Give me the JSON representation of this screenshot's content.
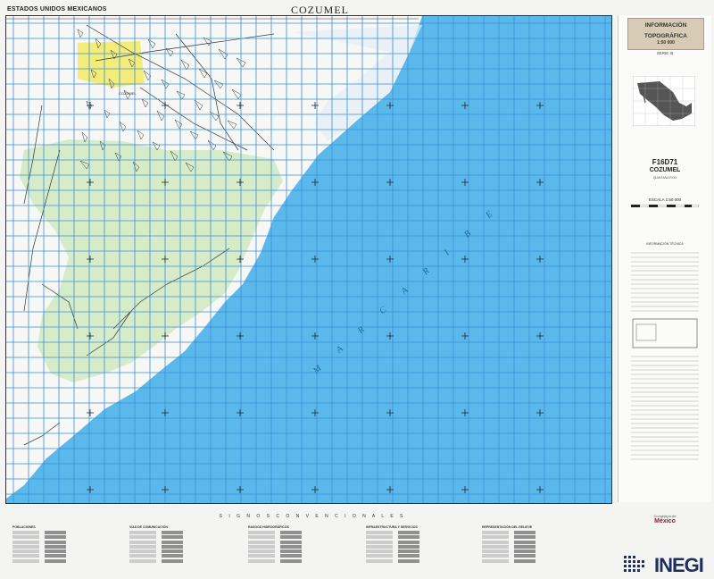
{
  "header": {
    "country": "ESTADOS UNIDOS MEXICANOS",
    "title": "COZUMEL"
  },
  "sidebar": {
    "badge_line1": "INFORMACIÓN",
    "badge_line2": "TOPOGRÁFICA",
    "badge_scale": "1:50 000",
    "series": "SERIE III",
    "sheet_code": "F16D71",
    "sheet_name": "COZUMEL",
    "sheet_state": "QUINTANA ROO",
    "scale_label": "ESCALA 1:50 000",
    "info_heading": "INFORMACIÓN TÉCNICA"
  },
  "map": {
    "sea_label": "M A R   C A R I B E",
    "town_label": "COZUMEL",
    "colors": {
      "sea": "#5bb8ea",
      "land": "#f7f7f5",
      "vegetation": "#d6ecc9",
      "urban": "#f3ec7a",
      "grid": "#3a8fd8"
    }
  },
  "legend": {
    "title": "S I G N O S   C O N V E N C I O N A L E S",
    "columns": [
      {
        "heading": "POBLACIONES"
      },
      {
        "heading": "VÍAS DE COMUNICACIÓN"
      },
      {
        "heading": "RASGOS HIDROGRÁFICOS"
      },
      {
        "heading": "INFRAESTRUCTURA Y SERVICIOS"
      },
      {
        "heading": "REPRESENTACIÓN DEL RELIEVE"
      }
    ]
  },
  "branding": {
    "mexico_line1": "Consejería de",
    "mexico_line2": "México",
    "inegi": "INEGI"
  }
}
